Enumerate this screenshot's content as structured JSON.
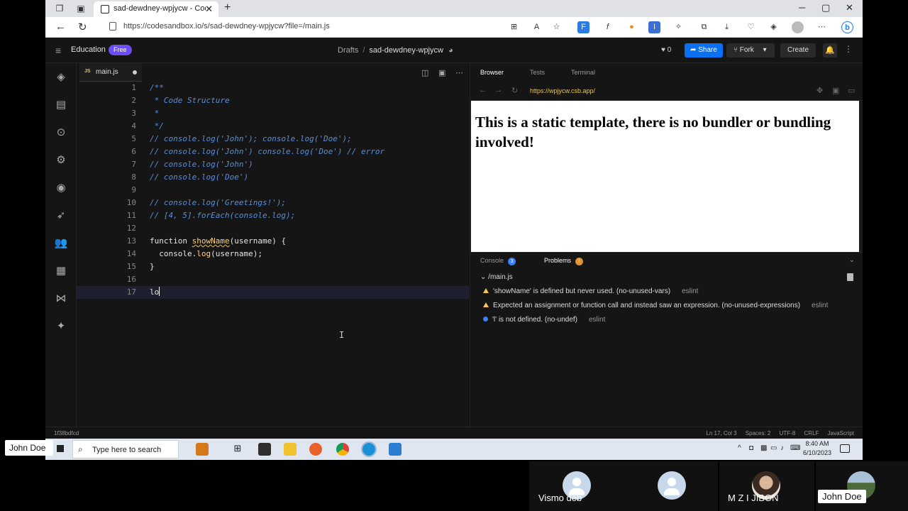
{
  "browser": {
    "tab_title": "sad-dewdney-wpjycw - CodeSandbox",
    "url": "https://codesandbox.io/s/sad-dewdney-wpjycw?file=/main.js"
  },
  "header": {
    "workspace": "Education",
    "plan_badge": "Free",
    "breadcrumb_folder": "Drafts",
    "breadcrumb_sep": "/",
    "sandbox_name": "sad-dewdney-wpjycw",
    "likes": "0",
    "share_label": "Share",
    "fork_label": "Fork",
    "create_label": "Create"
  },
  "editor": {
    "file_icon_label": "JS",
    "file_name": "main.js",
    "lines": [
      {
        "n": "1"
      },
      {
        "n": "2"
      },
      {
        "n": "3"
      },
      {
        "n": "4"
      },
      {
        "n": "5"
      },
      {
        "n": "6"
      },
      {
        "n": "7"
      },
      {
        "n": "8"
      },
      {
        "n": "9"
      },
      {
        "n": "10"
      },
      {
        "n": "11"
      },
      {
        "n": "12"
      },
      {
        "n": "13"
      },
      {
        "n": "14"
      },
      {
        "n": "15"
      },
      {
        "n": "16"
      },
      {
        "n": "17"
      }
    ],
    "code": {
      "l1": "/**",
      "l2": " * Code Structure",
      "l3": " *",
      "l4": " */",
      "l5": "// console.log('John'); console.log('Doe');",
      "l6": "// console.log('John') console.log('Doe') // error",
      "l7": "// console.log('John')",
      "l8": "// console.log('Doe')",
      "l10": "// console.log('Greetings!');",
      "l11": "// [4, 5].forEach(console.log);",
      "l13_kw": "function ",
      "l13_fn": "showName",
      "l13_rest": "(username) {",
      "l14_a": "  console.",
      "l14_m": "log",
      "l14_b": "(username);",
      "l15": "}",
      "l17": "lo"
    }
  },
  "preview": {
    "tabs": [
      "Browser",
      "Tests",
      "Terminal"
    ],
    "address": "https://wpjycw.csb.app/",
    "content_heading": "This is a static template, there is no bundler or bundling involved!"
  },
  "panel": {
    "console_label": "Console",
    "console_count": "3",
    "problems_label": "Problems",
    "problems_count": "!",
    "file": "/main.js",
    "problems": [
      {
        "text": "'showName' is defined but never used. (no-unused-vars)",
        "source": "eslint"
      },
      {
        "text": "Expected an assignment or function call and instead saw an expression. (no-unused-expressions)",
        "source": "eslint"
      },
      {
        "text": "'l' is not defined. (no-undef)",
        "source": "eslint"
      }
    ]
  },
  "status": {
    "commit": "1f38bdfcd",
    "position": "Ln 17, Col 3",
    "spaces": "Spaces: 2",
    "encoding": "UTF-8",
    "eol": "CRLF",
    "language": "JavaScript"
  },
  "taskbar": {
    "search_placeholder": "Type here to search",
    "time": "8:40 AM",
    "date": "6/10/2023"
  },
  "meeting": {
    "self_label": "John Doe",
    "participants": [
      "Vismo deb",
      "M Z I JIBON",
      "John Doe"
    ]
  },
  "colors": {
    "accent_share": "#0971f1",
    "badge_free": "#6d4df5",
    "comment": "#5a8ed6",
    "function_name": "#ffd27a",
    "warning": "#f5c451",
    "info": "#3b82f6"
  }
}
